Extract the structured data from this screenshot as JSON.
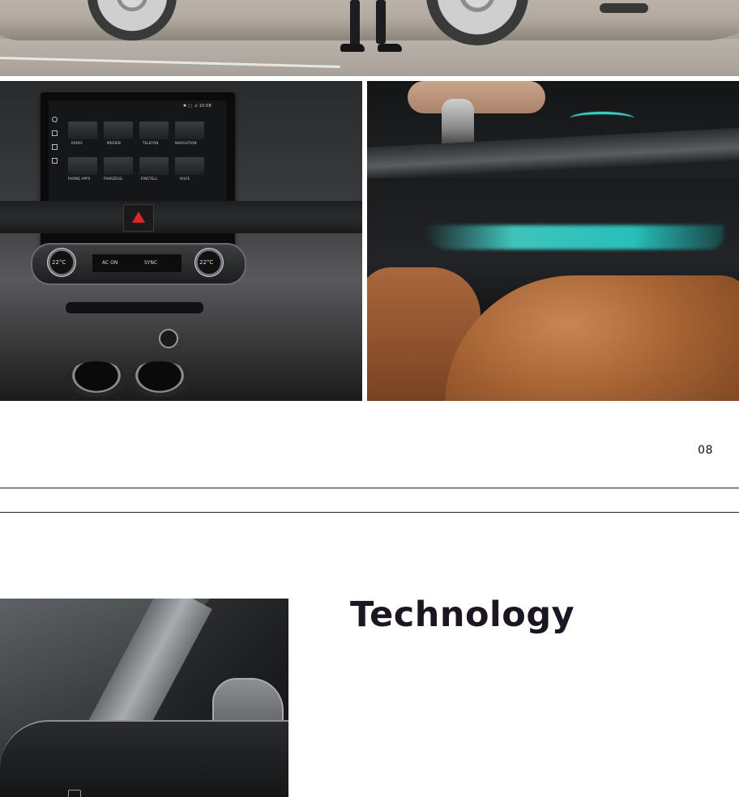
{
  "page": {
    "number": "08",
    "heading": "Technology"
  },
  "colors": {
    "heading": "#1b1621",
    "rule": "#222222",
    "ambient_light": "#3fe3d6",
    "hazard": "#d9262b",
    "leather": "#a46132"
  },
  "infotainment": {
    "status": "✱ ▢ .ıl 10:08",
    "tiles": [
      "RADIO",
      "MEDIEN",
      "TELEFON",
      "NAVIGATION",
      "PHONE APPS",
      "FAHRZEUG",
      "EINSTELL",
      "HILFE"
    ]
  },
  "climate": {
    "left_temp": "22°C",
    "right_temp": "22°C",
    "ac_label": "AC ON",
    "sync_label": "SYNC"
  },
  "images": [
    {
      "name": "exterior-strip",
      "icon": "car-wheels-image"
    },
    {
      "name": "dashboard",
      "icon": "dashboard-image"
    },
    {
      "name": "ambient-lighting",
      "icon": "ambient-light-image"
    },
    {
      "name": "a-pillar-interior",
      "icon": "interior-pillar-image"
    }
  ]
}
